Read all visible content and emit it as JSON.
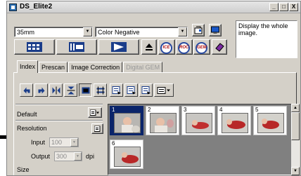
{
  "window": {
    "title": "DS_Elite2",
    "controls": [
      "_",
      "□",
      "X"
    ]
  },
  "toolbar": {
    "film_size": "35mm",
    "film_type": "Color Negative",
    "ice_label": "ICE",
    "roc_label": "ROC",
    "gem_label": "GEM",
    "hint_text": "Display the whole image."
  },
  "tabs": [
    {
      "label": "Index",
      "active": true,
      "disabled": false
    },
    {
      "label": "Prescan",
      "active": false,
      "disabled": false
    },
    {
      "label": "Image Correction",
      "active": false,
      "disabled": false
    },
    {
      "label": "Digital GEM",
      "active": false,
      "disabled": true
    }
  ],
  "left_panel": {
    "preset": "Default",
    "resolution_label": "Resolution",
    "input_label": "Input",
    "input_value": "100",
    "output_label": "Output",
    "output_value": "300",
    "output_unit": "dpi",
    "size_label": "Size"
  },
  "thumbnails": [
    {
      "num": "1",
      "selected": true
    },
    {
      "num": "2",
      "selected": false
    },
    {
      "num": "3",
      "selected": false
    },
    {
      "num": "4",
      "selected": false
    },
    {
      "num": "5",
      "selected": false
    },
    {
      "num": "6",
      "selected": false
    }
  ],
  "scrollbar": {
    "up": "▲",
    "down": "▼"
  }
}
